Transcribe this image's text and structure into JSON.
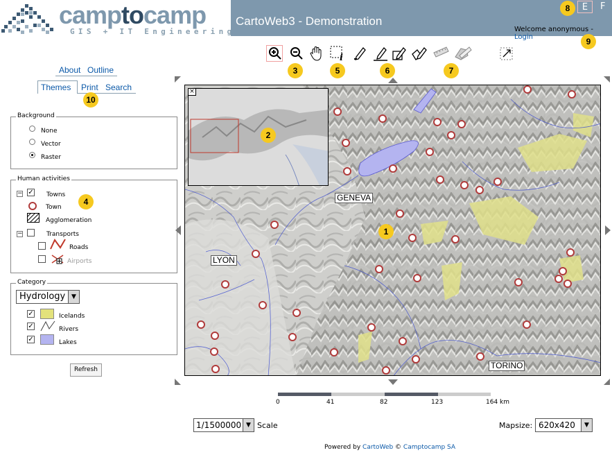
{
  "header": {
    "logo_text_1": "camp",
    "logo_text_2": "to",
    "logo_text_3": "camp",
    "logo_subtitle": "GIS + IT Engineering",
    "app_title": "CartoWeb3 - Demonstration",
    "lang_e": "E",
    "lang_f": "F",
    "welcome": "Welcome anonymous - ",
    "login": "Login"
  },
  "tabs": {
    "row1": [
      "About",
      "Outline"
    ],
    "row2": [
      "Themes",
      "Print",
      "Search"
    ]
  },
  "background": {
    "legend": "Background",
    "options": [
      "None",
      "Vector",
      "Raster"
    ],
    "selected": "Raster"
  },
  "human": {
    "legend": "Human activities",
    "towns": "Towns",
    "town": "Town",
    "agglomeration": "Agglomeration",
    "transports": "Transports",
    "roads": "Roads",
    "airports": "Airports"
  },
  "category": {
    "legend": "Category",
    "selected": "Hydrology",
    "icelands": "Icelands",
    "rivers": "Rivers",
    "lakes": "Lakes"
  },
  "refresh_label": "Refresh",
  "map": {
    "labels": [
      "GENEVA",
      "LYON",
      "TORINO"
    ]
  },
  "scalebar": {
    "ticks": [
      "0",
      "41",
      "82",
      "123",
      "164 km"
    ]
  },
  "scale": {
    "value": "1/1500000",
    "label": "Scale"
  },
  "mapsize": {
    "label": "Mapsize:",
    "value": "620x420"
  },
  "footer": {
    "prefix": "Powered by ",
    "link1": "CartoWeb",
    "mid": " © ",
    "link2": "Camptocamp SA"
  },
  "callouts": [
    "1",
    "2",
    "3",
    "4",
    "5",
    "6",
    "7",
    "8",
    "9",
    "10"
  ],
  "colors": {
    "header": "#7e98ad",
    "link": "#0b59a8",
    "city": "#b03b3b",
    "callout": "#f6c91f"
  }
}
